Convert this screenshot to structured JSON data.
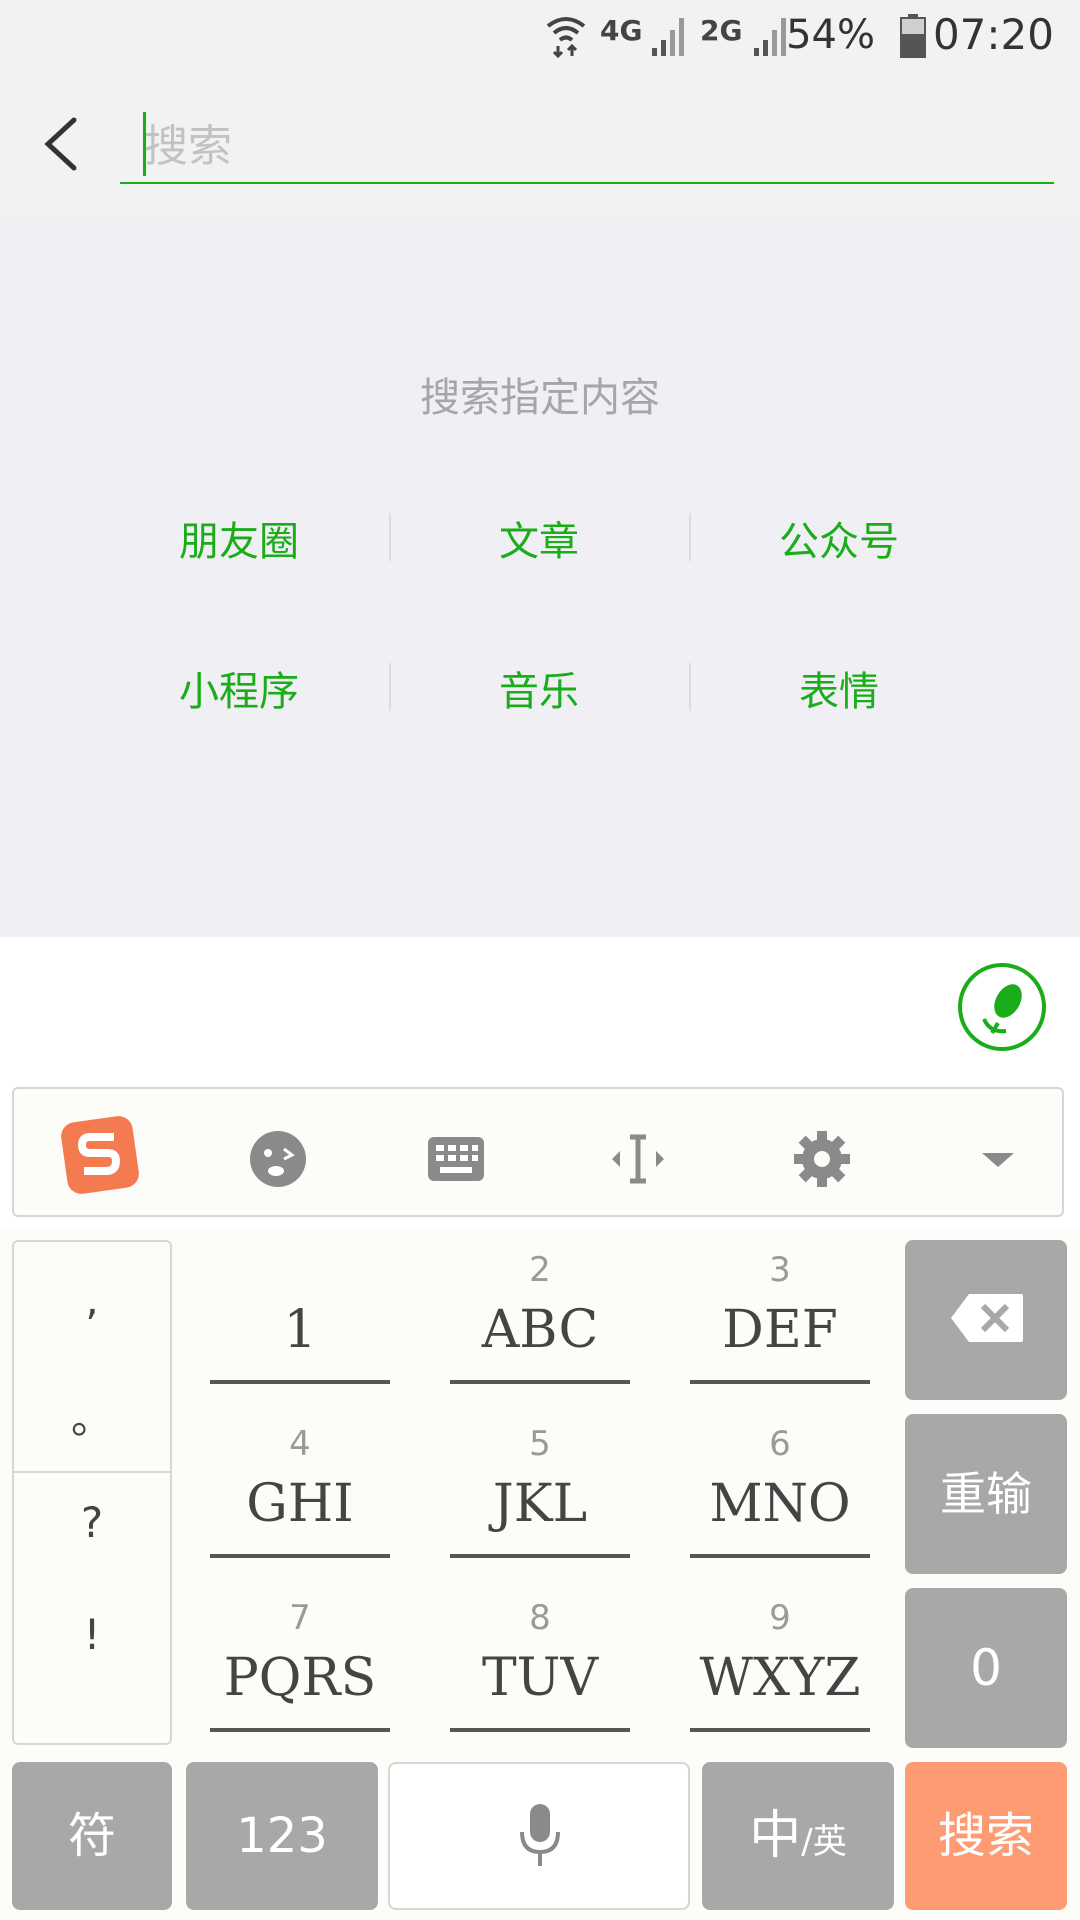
{
  "status_bar": {
    "network_1": "4G",
    "network_2": "2G",
    "battery": "54%",
    "time": "07:20"
  },
  "search": {
    "placeholder": "搜索"
  },
  "content": {
    "hint": "搜索指定内容",
    "categories": [
      {
        "label": "朋友圈"
      },
      {
        "label": "文章"
      },
      {
        "label": "公众号"
      },
      {
        "label": "小程序"
      },
      {
        "label": "音乐"
      },
      {
        "label": "表情"
      }
    ]
  },
  "keyboard": {
    "symbols": [
      ",",
      "。",
      "?",
      "!"
    ],
    "keys": [
      {
        "num": "",
        "letters": "1"
      },
      {
        "num": "2",
        "letters": "ABC"
      },
      {
        "num": "3",
        "letters": "DEF"
      },
      {
        "num": "4",
        "letters": "GHI"
      },
      {
        "num": "5",
        "letters": "JKL"
      },
      {
        "num": "6",
        "letters": "MNO"
      },
      {
        "num": "7",
        "letters": "PQRS"
      },
      {
        "num": "8",
        "letters": "TUV"
      },
      {
        "num": "9",
        "letters": "WXYZ"
      }
    ],
    "reenter_label": "重输",
    "zero_label": "0",
    "symbols_label": "符",
    "numbers_label": "123",
    "lang_main": "中",
    "lang_sub": "/英",
    "search_label": "搜索"
  },
  "colors": {
    "accent": "#1aad19",
    "search_key": "#ff9b73",
    "function_key": "#a8a8a8"
  }
}
